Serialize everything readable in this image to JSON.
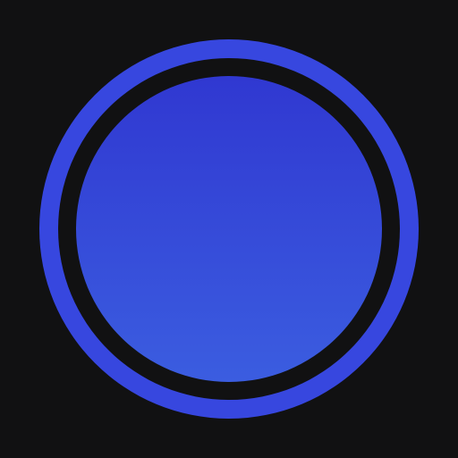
{
  "icon": {
    "name": "circle-button-icon",
    "colors": {
      "background": "#111112",
      "outer_ring": "#3747DF",
      "gap_ring": "#111112",
      "inner_top": "#3038D1",
      "inner_bottom": "#3B5DE0"
    }
  }
}
